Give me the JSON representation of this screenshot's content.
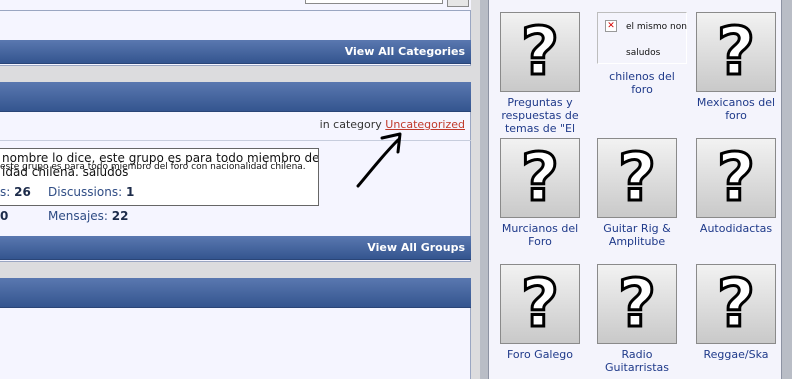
{
  "categories_panel": {
    "view_all_label": "View All Categories"
  },
  "group_panel": {
    "category_prefix": "in category",
    "category_link": "Uncategorized",
    "description_large": "nombre lo dice, este grupo es para todo miembro del foro con",
    "description_small": "este grupo es para todo miembro del foro con nacionalidad chilena.",
    "description_large2": "idad chilena. saludos",
    "stats": {
      "members_label": "s:",
      "members_value": "26",
      "discussions_label": "Discussions:",
      "discussions_value": "1",
      "left_value": "0",
      "messages_label": "Mensajes:",
      "messages_value": "22"
    },
    "view_all_label": "View All Groups"
  },
  "groups_sidebar": {
    "tiles": [
      {
        "label": "Preguntas y respuestas de temas de \"El",
        "icon": "question-mark-icon"
      },
      {
        "label": "chilenos del foro",
        "icon": "broken-image-icon",
        "alt_line1": "el mismo non",
        "alt_line2": "saludos"
      },
      {
        "label": "Mexicanos del foro",
        "icon": "question-mark-icon"
      },
      {
        "label": "Murcianos del Foro",
        "icon": "question-mark-icon"
      },
      {
        "label": "Guitar Rig & Amplitube",
        "icon": "question-mark-icon"
      },
      {
        "label": "Autodidactas",
        "icon": "question-mark-icon"
      },
      {
        "label": "Foro Galego",
        "icon": "question-mark-icon"
      },
      {
        "label": "Radio Guitarristas",
        "icon": "question-mark-icon"
      },
      {
        "label": "Reggae/Ska",
        "icon": "question-mark-icon"
      }
    ],
    "placeholder_glyph": "?"
  },
  "colors": {
    "bar": "#3d5c96",
    "link": "#c0392b",
    "tile_text": "#1f3a8a",
    "background": "#f5f5ff"
  }
}
